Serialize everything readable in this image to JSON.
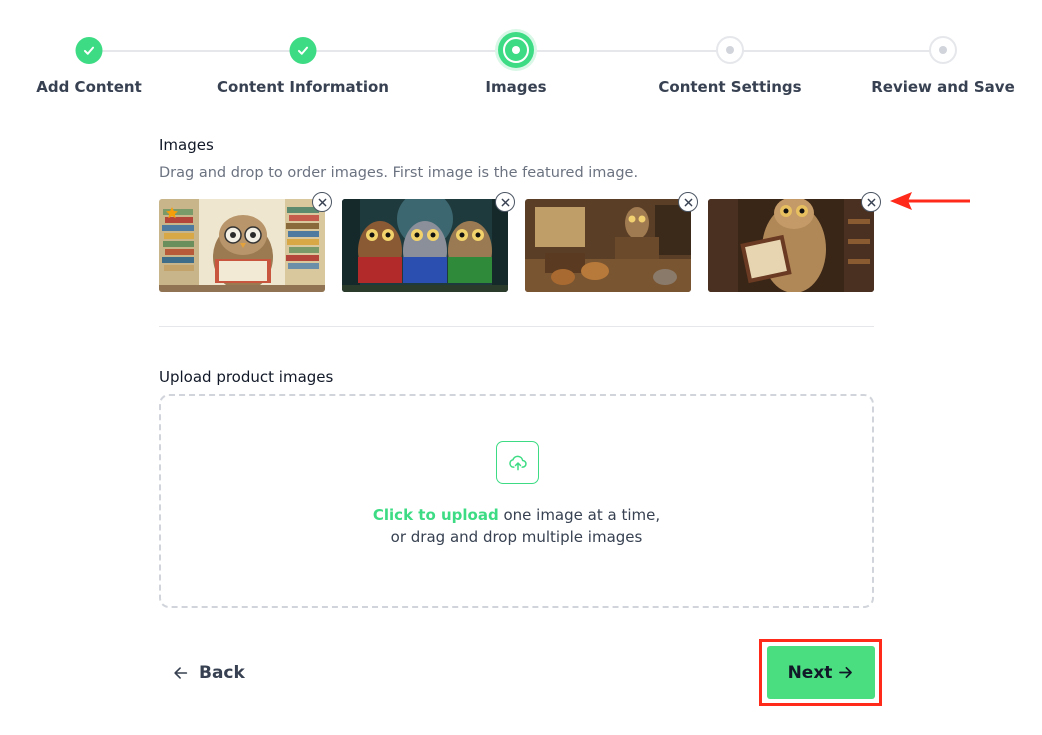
{
  "stepper": {
    "steps": [
      {
        "label": "Add Content",
        "state": "done"
      },
      {
        "label": "Content Information",
        "state": "done"
      },
      {
        "label": "Images",
        "state": "current"
      },
      {
        "label": "Content Settings",
        "state": "todo"
      },
      {
        "label": "Review and Save",
        "state": "todo"
      }
    ]
  },
  "images_section": {
    "title": "Images",
    "hint": "Drag and drop to order images. First image is the featured image.",
    "thumbnails": [
      {
        "icon": "owl-reading-books-image",
        "featured": true
      },
      {
        "icon": "three-owls-reading-image",
        "featured": false
      },
      {
        "icon": "owl-classroom-image",
        "featured": false
      },
      {
        "icon": "owl-with-book-image",
        "featured": false
      }
    ]
  },
  "upload": {
    "title": "Upload product images",
    "link_text": "Click to upload",
    "text_rest": " one image at a time,",
    "text_line2": "or drag and drop multiple images"
  },
  "nav": {
    "back_label": "Back",
    "next_label": "Next"
  },
  "colors": {
    "accent": "#3ddc84",
    "highlight": "#ff2a1a"
  }
}
